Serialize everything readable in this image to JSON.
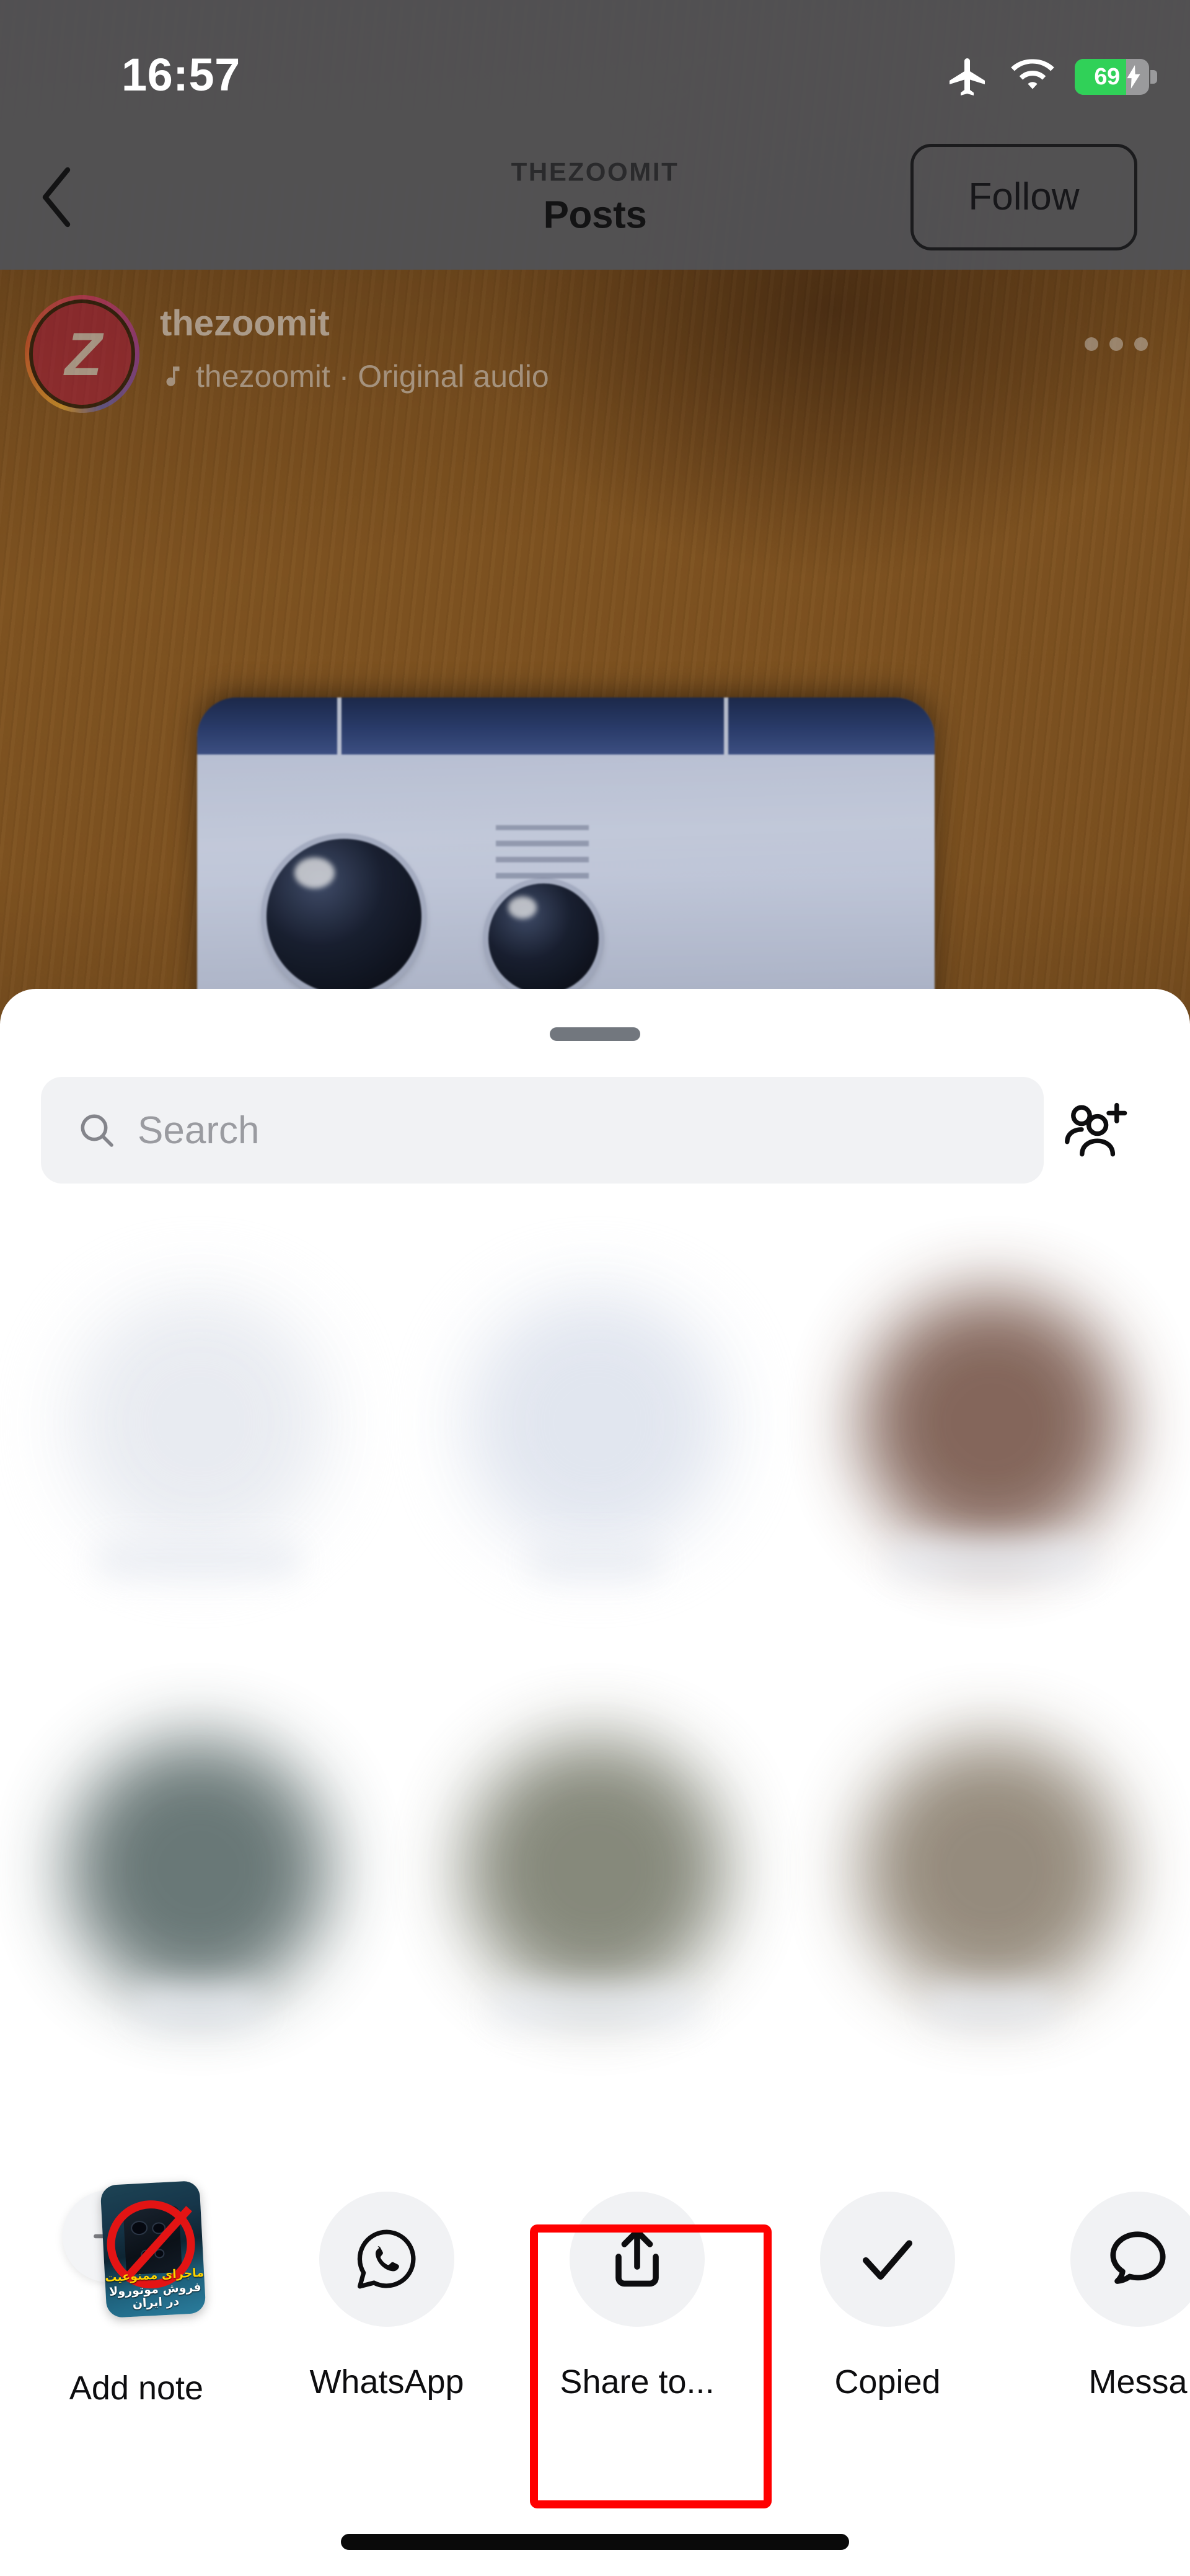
{
  "status_bar": {
    "time": "16:57",
    "airplane_icon": "airplane-mode-icon",
    "wifi_icon": "wifi-icon",
    "battery_percent": "69",
    "battery_charging": true,
    "battery_fill_color": "#30d158"
  },
  "nav": {
    "back_icon": "back-chevron-icon",
    "eyebrow": "THEZOOMIT",
    "title": "Posts",
    "follow_label": "Follow"
  },
  "post": {
    "avatar_initial": "Z",
    "username": "thezoomit",
    "audio_icon": "music-note-icon",
    "audio_label": "thezoomit · Original audio",
    "more_icon": "more-options-icon"
  },
  "sheet": {
    "grabber": "drag-handle",
    "search": {
      "icon": "search-icon",
      "placeholder": "Search",
      "value": ""
    },
    "add_people_icon": "add-people-icon",
    "contacts_note": "contact avatars blurred for privacy",
    "contacts": [
      {
        "blur_color": "#e7eaf0"
      },
      {
        "blur_color": "#dfe4ee"
      },
      {
        "blur_color": "#e3e7ef"
      },
      {
        "blur_color": "#c8c2bc"
      },
      {
        "blur_color": "#e6e8ee"
      },
      {
        "blur_color": "#7a5a4e"
      },
      {
        "blur_color": "#5d6d6c"
      },
      {
        "blur_color": "#7c7f70"
      },
      {
        "blur_color": "#8d8272"
      }
    ]
  },
  "share_row": {
    "items": [
      {
        "label": "Add note",
        "icon": "add-note-thumbnail",
        "highlighted": false
      },
      {
        "label": "WhatsApp",
        "icon": "whatsapp-icon",
        "highlighted": false
      },
      {
        "label": "Share to...",
        "icon": "share-up-arrow-icon",
        "highlighted": true
      },
      {
        "label": "Copied",
        "icon": "checkmark-icon",
        "highlighted": false
      },
      {
        "label": "Messa",
        "icon": "message-bubble-icon",
        "highlighted": false
      }
    ],
    "note_thumbnail": {
      "line1": "ماجرای ممنوعیت",
      "line2": "فروش موتورولا در ایران",
      "line1_color": "#ffd400",
      "line2_color": "#ffffff",
      "overlay_icon": "prohibition-sign-icon"
    },
    "plus_icon": "plus-icon"
  },
  "annotation": {
    "color": "#ff0000",
    "target": "share-to-button"
  },
  "home_indicator": "home-indicator"
}
